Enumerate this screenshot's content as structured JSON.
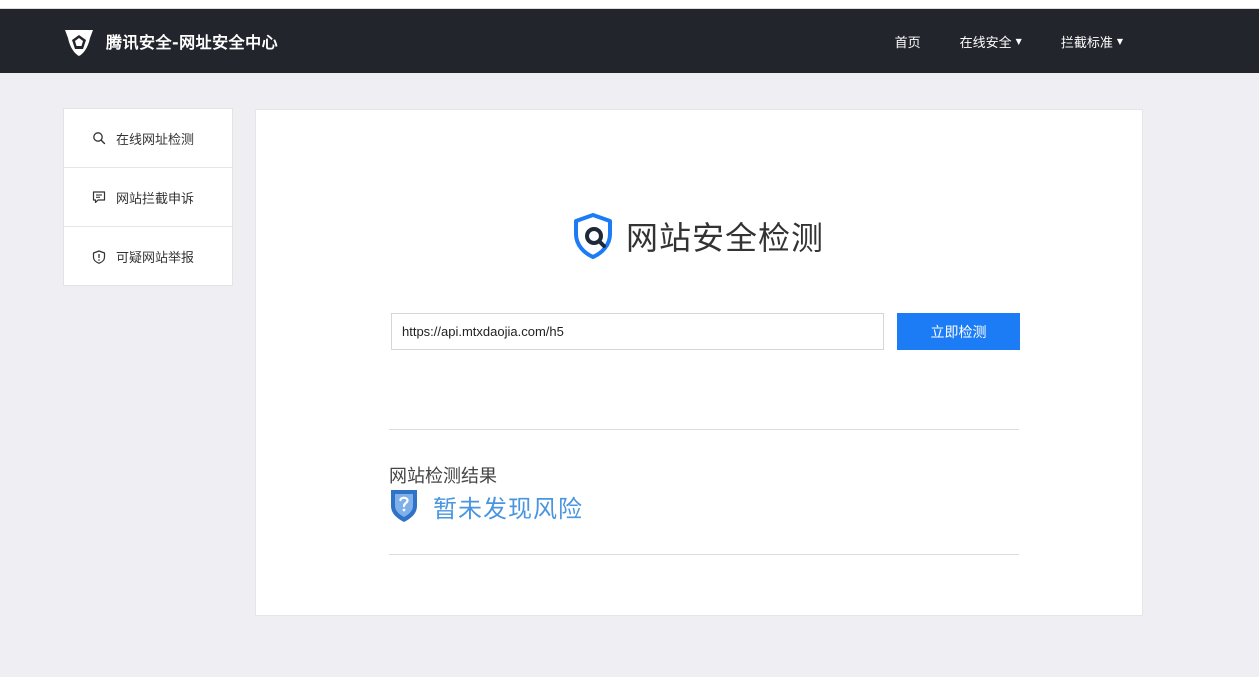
{
  "header": {
    "brand": "腾讯安全-网址安全中心",
    "nav": [
      {
        "label": "首页",
        "dropdown": false
      },
      {
        "label": "在线安全",
        "dropdown": true
      },
      {
        "label": "拦截标准",
        "dropdown": true
      }
    ],
    "caret": "▼"
  },
  "sidebar": {
    "items": [
      {
        "label": "在线网址检测",
        "icon": "search-icon"
      },
      {
        "label": "网站拦截申诉",
        "icon": "chat-icon"
      },
      {
        "label": "可疑网站举报",
        "icon": "shield-alert-icon"
      }
    ]
  },
  "main": {
    "title": "网站安全检测",
    "url_value": "https://api.mtxdaojia.com/h5",
    "button_label": "立即检测",
    "result_label": "网站检测结果",
    "result_text": "暂未发现风险"
  },
  "colors": {
    "navbar": "#23252d",
    "accent": "#1b7cf5",
    "result": "#4a95e0",
    "background": "#efeff3"
  }
}
